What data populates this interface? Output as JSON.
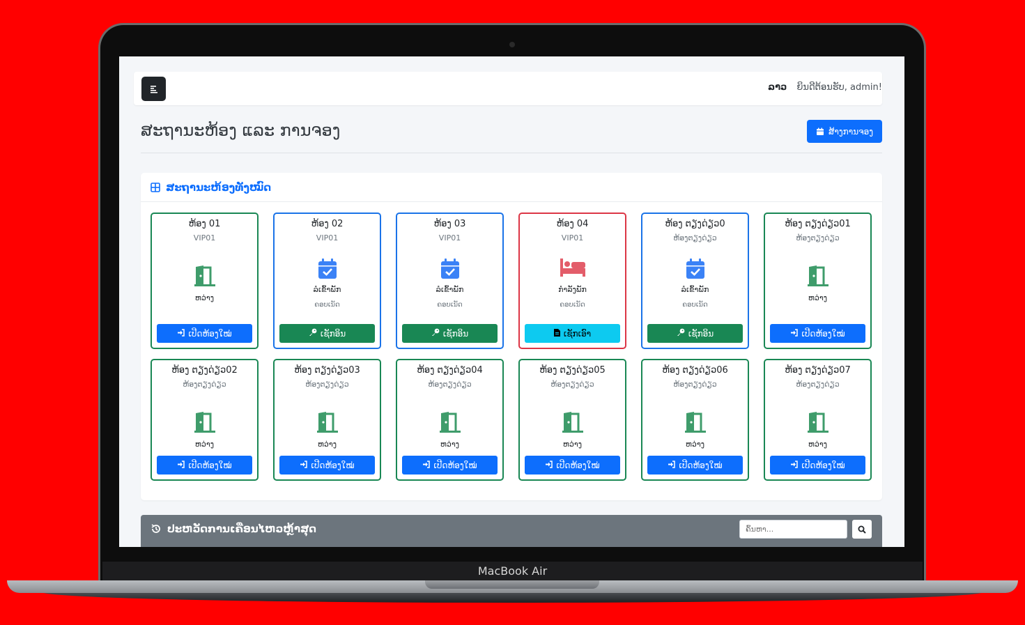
{
  "device": {
    "label": "MacBook Air"
  },
  "navbar": {
    "lang": "ລາວ",
    "welcome": "ຍິນດີຕ້ອນຮັບ, admin!"
  },
  "page": {
    "title": "ສະຖານະຫ້ອງ ແລະ ການຈອງ",
    "new_booking_label": "ສ້າງການຈອງ"
  },
  "rooms_card": {
    "title": "ສະຖານະຫ້ອງທັງໝົດ"
  },
  "colors": {
    "available": "#198754",
    "reserved": "#1a73e8",
    "occupied": "#dc3545",
    "primary": "#0d6efd",
    "info": "#0dcaf0"
  },
  "rooms": [
    {
      "name": "ຫ້ອງ 01",
      "type": "VIP01",
      "state": "available",
      "status": "ຫວ່າງ",
      "sub": "",
      "icon": "door-open-icon",
      "button": "ເປີດຫ້ອງໃໝ່",
      "button_icon": "sign-in-icon"
    },
    {
      "name": "ຫ້ອງ 02",
      "type": "VIP01",
      "state": "reserved",
      "status": "ລໍເຂົ້າພັກ",
      "sub": "ຄອບເນັດ",
      "icon": "calendar-check-icon",
      "button": "ເຊັກອິນ",
      "button_icon": "key-icon"
    },
    {
      "name": "ຫ້ອງ 03",
      "type": "VIP01",
      "state": "reserved",
      "status": "ລໍເຂົ້າພັກ",
      "sub": "ຄອບເນັດ",
      "icon": "calendar-check-icon",
      "button": "ເຊັກອິນ",
      "button_icon": "key-icon"
    },
    {
      "name": "ຫ້ອງ 04",
      "type": "VIP01",
      "state": "occupied",
      "status": "ກຳລັງພັກ",
      "sub": "ຄອບເນັດ",
      "icon": "bed-icon",
      "button": "ເຊັກເອົາ",
      "button_icon": "file-icon"
    },
    {
      "name": "ຫ້ອງ ຕຽງດ່ຽວ0",
      "type": "ຫ້ອງຕຽງດ່ຽວ",
      "state": "reserved",
      "status": "ລໍເຂົ້າພັກ",
      "sub": "ຄອບເນັດ",
      "icon": "calendar-check-icon",
      "button": "ເຊັກອິນ",
      "button_icon": "key-icon"
    },
    {
      "name": "ຫ້ອງ ຕຽງດ່ຽວ01",
      "type": "ຫ້ອງຕຽງດ່ຽວ",
      "state": "available",
      "status": "ຫວ່າງ",
      "sub": "",
      "icon": "door-open-icon",
      "button": "ເປີດຫ້ອງໃໝ່",
      "button_icon": "sign-in-icon"
    },
    {
      "name": "ຫ້ອງ ຕຽງດ່ຽວ02",
      "type": "ຫ້ອງຕຽງດ່ຽວ",
      "state": "available",
      "status": "ຫວ່າງ",
      "sub": "",
      "icon": "door-open-icon",
      "button": "ເປີດຫ້ອງໃໝ່",
      "button_icon": "sign-in-icon"
    },
    {
      "name": "ຫ້ອງ ຕຽງດ່ຽວ03",
      "type": "ຫ້ອງຕຽງດ່ຽວ",
      "state": "available",
      "status": "ຫວ່າງ",
      "sub": "",
      "icon": "door-open-icon",
      "button": "ເປີດຫ້ອງໃໝ່",
      "button_icon": "sign-in-icon"
    },
    {
      "name": "ຫ້ອງ ຕຽງດ່ຽວ04",
      "type": "ຫ້ອງຕຽງດ່ຽວ",
      "state": "available",
      "status": "ຫວ່າງ",
      "sub": "",
      "icon": "door-open-icon",
      "button": "ເປີດຫ້ອງໃໝ່",
      "button_icon": "sign-in-icon"
    },
    {
      "name": "ຫ້ອງ ຕຽງດ່ຽວ05",
      "type": "ຫ້ອງຕຽງດ່ຽວ",
      "state": "available",
      "status": "ຫວ່າງ",
      "sub": "",
      "icon": "door-open-icon",
      "button": "ເປີດຫ້ອງໃໝ່",
      "button_icon": "sign-in-icon"
    },
    {
      "name": "ຫ້ອງ ຕຽງດ່ຽວ06",
      "type": "ຫ້ອງຕຽງດ່ຽວ",
      "state": "available",
      "status": "ຫວ່າງ",
      "sub": "",
      "icon": "door-open-icon",
      "button": "ເປີດຫ້ອງໃໝ່",
      "button_icon": "sign-in-icon"
    },
    {
      "name": "ຫ້ອງ ຕຽງດ່ຽວ07",
      "type": "ຫ້ອງຕຽງດ່ຽວ",
      "state": "available",
      "status": "ຫວ່າງ",
      "sub": "",
      "icon": "door-open-icon",
      "button": "ເປີດຫ້ອງໃໝ່",
      "button_icon": "sign-in-icon"
    }
  ],
  "history": {
    "title": "ປະຫວັດການເຄື່ອນໄຫວຫຼ້າສຸດ",
    "search_placeholder": "ຄົ້ນຫາ...",
    "search_value": ""
  }
}
